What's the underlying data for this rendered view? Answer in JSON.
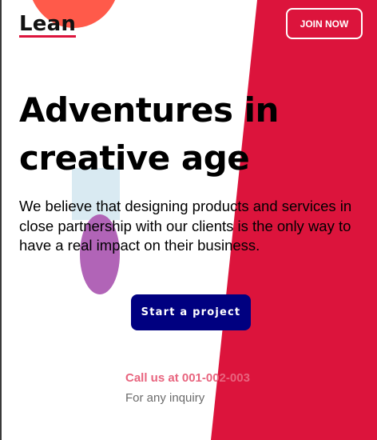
{
  "header": {
    "logo": "Lean",
    "join_label": "JOIN NOW"
  },
  "hero": {
    "title_line1": "Adventures in",
    "title_line2": "creative age",
    "description": "We believe that designing products and services in close partnership with our clients is the only way to have a real impact on their business.",
    "cta_label": "Start a project"
  },
  "contact": {
    "call_text": "Call us at 001-002-003",
    "note": "For any inquiry"
  },
  "colors": {
    "accent_red": "#dc143c",
    "orange": "#ff5a4a",
    "navy": "#000080",
    "pink": "#e8647e",
    "purple": "#b164b7",
    "light_blue": "#d9eaf2"
  }
}
